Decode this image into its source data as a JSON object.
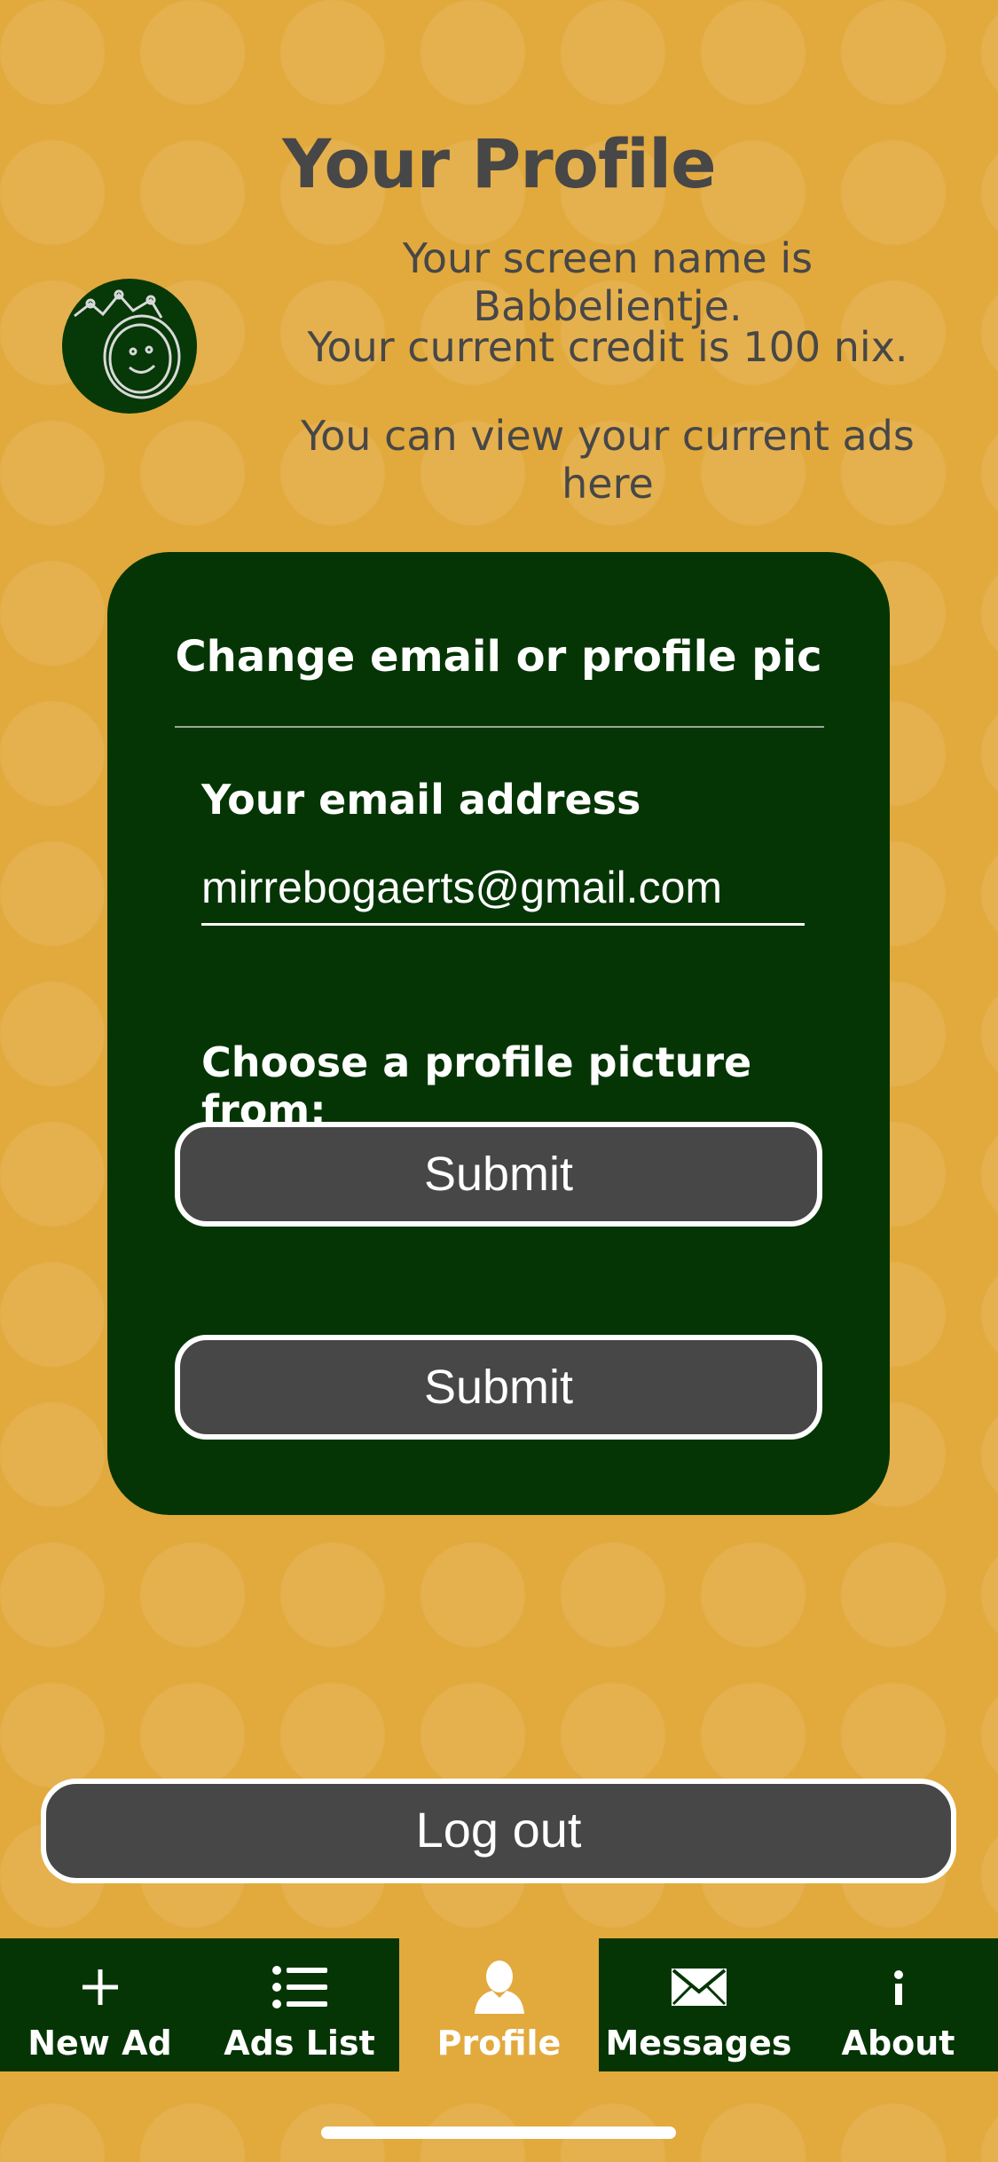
{
  "header": {
    "title": "Your Profile",
    "screen_name_line": "Your screen name is Babbelientje.",
    "credit_line": "Your current credit is 100 nix.",
    "ads_line": "You can view your current ads here"
  },
  "card": {
    "title": "Change email or profile pic",
    "email_label": "Your email address",
    "email_value": "mirrebogaerts@gmail.com",
    "picture_label": "Choose a profile picture from:",
    "submit_1": "Submit",
    "submit_2": "Submit"
  },
  "logout_label": "Log out",
  "tabbar": {
    "active": "profile",
    "tabs": [
      {
        "label": "New Ad",
        "icon": "plus-icon"
      },
      {
        "label": "Ads List",
        "icon": "list-icon"
      },
      {
        "label": "Profile",
        "icon": "person-icon"
      },
      {
        "label": "Messages",
        "icon": "envelope-icon"
      },
      {
        "label": "About",
        "icon": "info-icon"
      }
    ]
  },
  "colors": {
    "background": "#e2a93d",
    "card": "#053505",
    "button": "#474747",
    "text_dark": "#474747"
  }
}
